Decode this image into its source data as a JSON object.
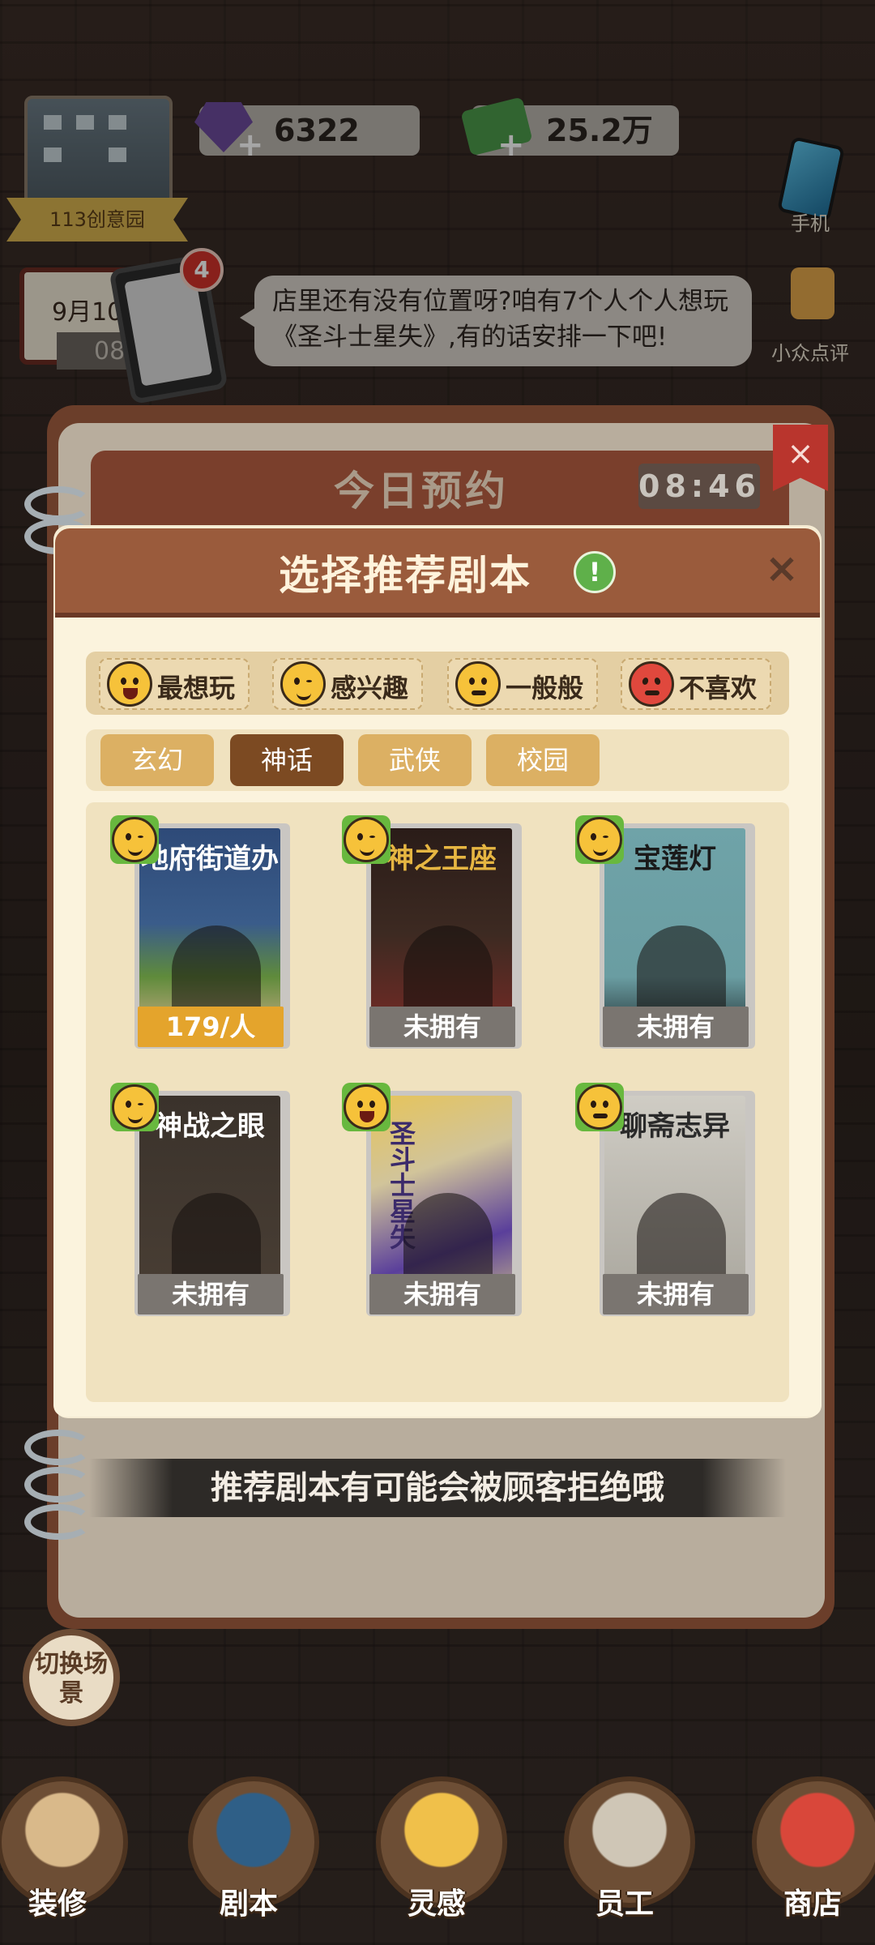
{
  "top": {
    "location_label": "113创意园",
    "gems": "6322",
    "money": "25.2万",
    "phone_label": "手机",
    "review_label": "小众点评",
    "date": "9月10",
    "time": "08:46",
    "notification_count": "4",
    "customer_message": "店里还有没有位置呀?咱有7个人个人想玩《圣斗士星失》,有的话安排一下吧!"
  },
  "notebook": {
    "title": "今日预约",
    "clock": "08:46",
    "close": "×",
    "tip": "推荐剧本有可能会被顾客拒绝哦"
  },
  "modal": {
    "title": "选择推荐剧本",
    "info": "!",
    "close": "×",
    "legend": [
      {
        "label": "最想玩",
        "mood": "love"
      },
      {
        "label": "感兴趣",
        "mood": "interested"
      },
      {
        "label": "一般般",
        "mood": "neutral"
      },
      {
        "label": "不喜欢",
        "mood": "dislike"
      }
    ],
    "categories": [
      "玄幻",
      "神话",
      "武侠",
      "校园"
    ],
    "active_category": "神话",
    "scripts": [
      {
        "title": "地府街道办",
        "status": "179/人",
        "mood": "interested"
      },
      {
        "title": "神之王座",
        "status": "未拥有",
        "mood": "interested"
      },
      {
        "title": "宝莲灯",
        "status": "未拥有",
        "mood": "interested"
      },
      {
        "title": "神战之眼",
        "status": "未拥有",
        "mood": "interested"
      },
      {
        "title": "圣斗士星失",
        "status": "未拥有",
        "mood": "love"
      },
      {
        "title": "聊斋志异",
        "status": "未拥有",
        "mood": "neutral"
      }
    ]
  },
  "nav": {
    "switch_scene": "切换场景",
    "items": [
      "装修",
      "剧本",
      "灵感",
      "员工",
      "商店"
    ]
  }
}
